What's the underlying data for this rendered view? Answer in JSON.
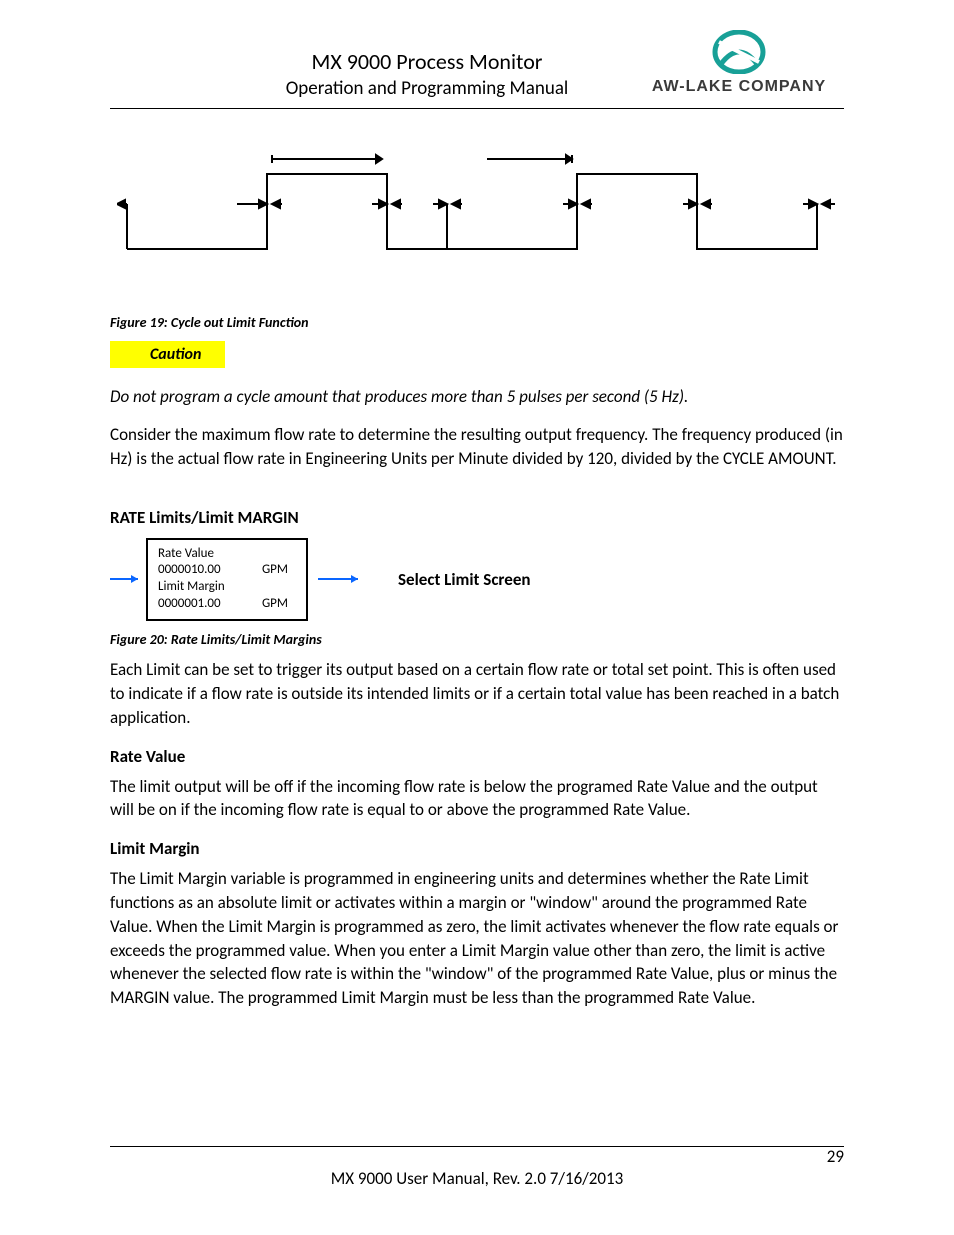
{
  "header": {
    "title": "MX 9000 Process Monitor",
    "subtitle": "Operation and Programming Manual",
    "company": "AW-LAKE COMPANY"
  },
  "fig19_caption": "Figure 19: Cycle out Limit Function",
  "caution_label": "Caution",
  "caution_text": "Do not program a cycle amount that produces more than 5 pulses per second (5 Hz).",
  "para1": "Consider the maximum flow rate to determine the resulting output frequency. The frequency produced (in Hz) is the actual flow rate in Engineering Units per Minute divided by 120, divided by the CYCLE AMOUNT.",
  "section_heading": "RATE Limits/Limit MARGIN",
  "rate_box": {
    "l1": "Rate Value",
    "l2_left": "0000010.00",
    "l2_right": "GPM",
    "l3": "Limit Margin",
    "l4_left": "0000001.00",
    "l4_right": "GPM"
  },
  "select_limit": "Select Limit Screen",
  "fig20_caption": "Figure 20: Rate Limits/Limit Margins",
  "para2": "Each Limit can be set to trigger its output based on a certain flow rate or total set point.  This is often used to indicate if a flow rate is outside its intended limits or if a certain total value has been reached in a batch application.",
  "sub1": "Rate Value",
  "para3": "The limit output will be off if the incoming flow rate is below the programed Rate Value and the output will be on if the incoming flow rate is equal to or above the programmed Rate Value.",
  "sub2": "Limit Margin",
  "para4": "The Limit Margin variable is programmed in engineering units and determines whether the Rate Limit functions as an absolute limit or activates within a margin or \"window\" around the programmed Rate Value. When the Limit Margin is programmed as zero, the limit activates whenever the flow rate equals or exceeds the programmed value. When you enter a Limit Margin value other than zero, the limit is active whenever the selected flow rate is within the \"window\" of the programmed Rate Value, plus or minus the MARGIN value.  The programmed Limit Margin must be less than the programmed Rate Value.",
  "footer_text": "MX 9000 User Manual, Rev. 2.0        7/16/2013",
  "page_number": "29"
}
